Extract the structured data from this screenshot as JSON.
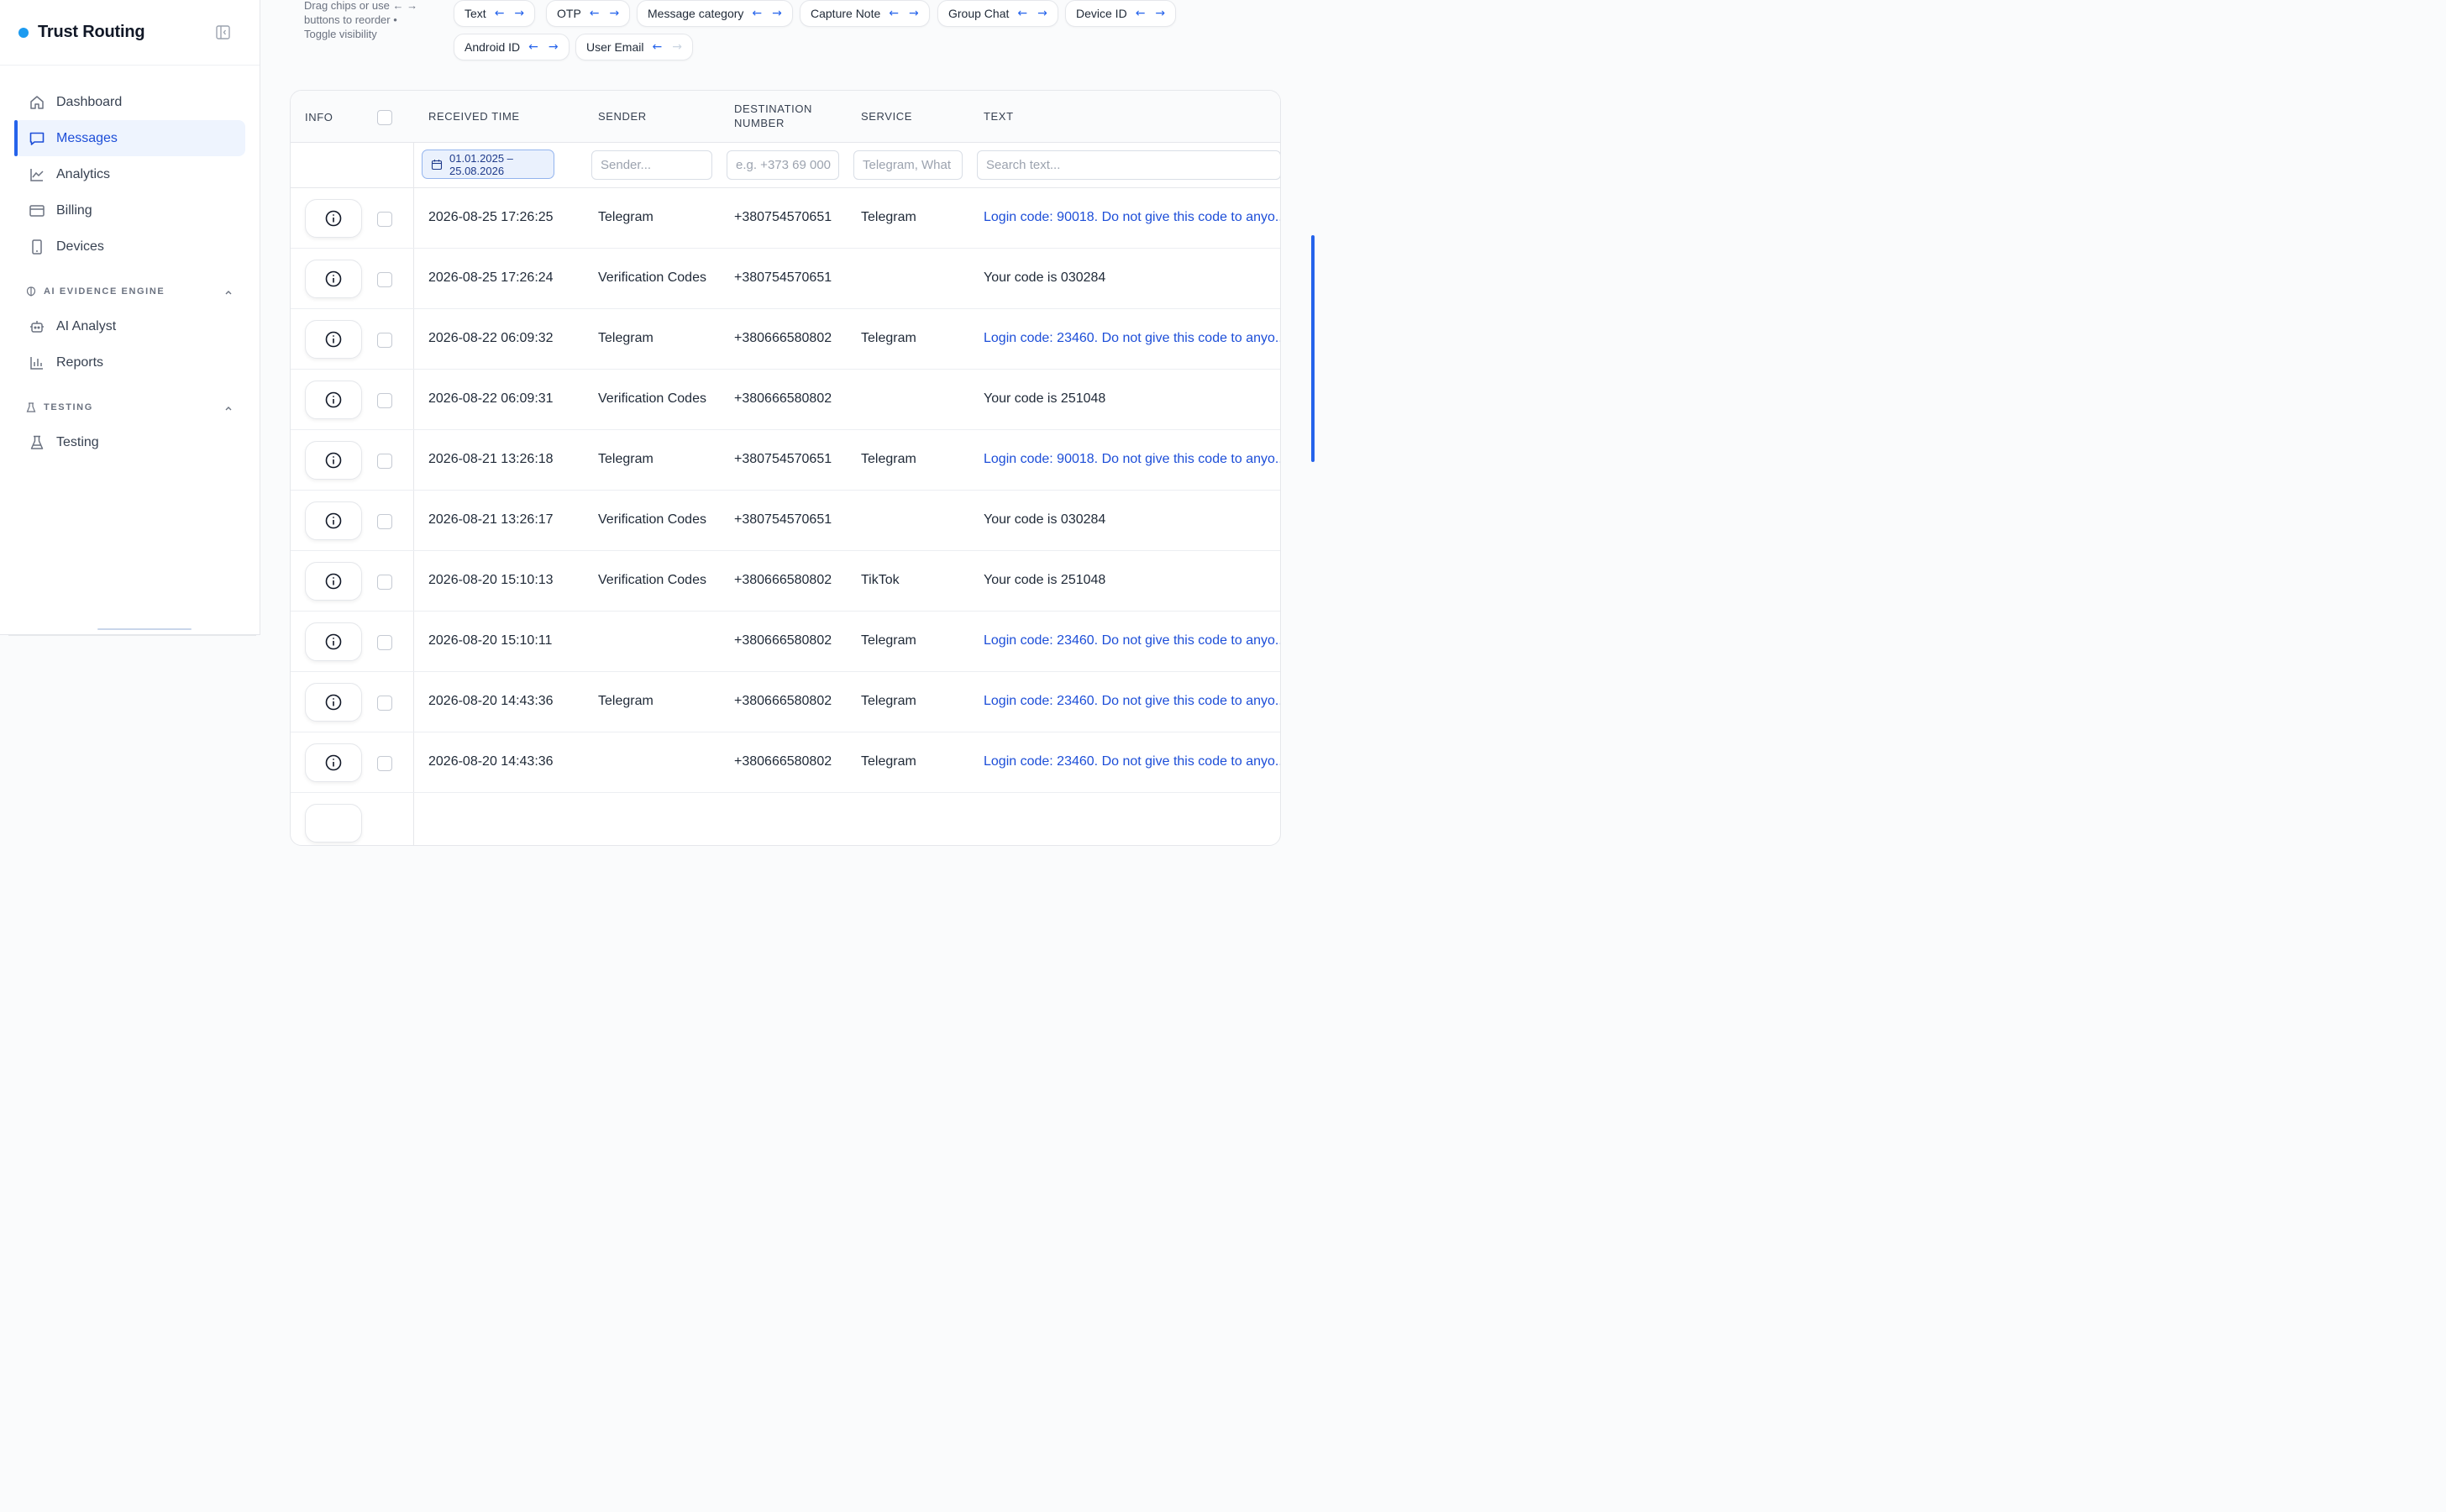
{
  "app": {
    "name": "Trust Routing",
    "brand_color": "#1d9bf0"
  },
  "sidebar": {
    "items": [
      {
        "label": "Dashboard",
        "icon": "home-icon"
      },
      {
        "label": "Messages",
        "icon": "message-icon",
        "active": true
      },
      {
        "label": "Analytics",
        "icon": "chart-line-icon"
      },
      {
        "label": "Billing",
        "icon": "credit-card-icon"
      },
      {
        "label": "Devices",
        "icon": "smartphone-icon"
      }
    ],
    "sections": [
      {
        "title": "AI EVIDENCE ENGINE",
        "icon": "brain-icon",
        "items": [
          {
            "label": "AI Analyst",
            "icon": "bot-icon"
          },
          {
            "label": "Reports",
            "icon": "bar-chart-icon"
          }
        ]
      },
      {
        "title": "TESTING",
        "icon": "flask-icon",
        "items": [
          {
            "label": "Testing",
            "icon": "flask-icon"
          }
        ]
      }
    ]
  },
  "columns_hint": "Drag chips or use ← → buttons to reorder • Toggle visibility",
  "column_chips": [
    "Text",
    "OTP",
    "Message category",
    "Capture Note",
    "Group Chat",
    "Device ID",
    "Android ID",
    "User Email"
  ],
  "table": {
    "headers": {
      "info": "INFO",
      "received": "RECEIVED TIME",
      "sender": "SENDER",
      "destination": "DESTINATION NUMBER",
      "service": "SERVICE",
      "text": "TEXT"
    },
    "filters": {
      "date_range": "01.01.2025 – 25.08.2026",
      "sender_placeholder": "Sender...",
      "destination_placeholder": "e.g. +373 69 000",
      "service_placeholder": "Telegram, What",
      "text_placeholder": "Search text..."
    },
    "rows": [
      {
        "time": "2026-08-25 17:26:25",
        "sender": "Telegram",
        "destination": "+380754570651",
        "service": "Telegram",
        "text": "Login code: 90018. Do not give this code to anyo...",
        "link": true
      },
      {
        "time": "2026-08-25 17:26:24",
        "sender": "Verification Codes",
        "destination": "+380754570651",
        "service": "",
        "text": "Your code is 030284",
        "link": false
      },
      {
        "time": "2026-08-22 06:09:32",
        "sender": "Telegram",
        "destination": "+380666580802",
        "service": "Telegram",
        "text": "Login code: 23460. Do not give this code to anyo...",
        "link": true
      },
      {
        "time": "2026-08-22 06:09:31",
        "sender": "Verification Codes",
        "destination": "+380666580802",
        "service": "",
        "text": "Your code is 251048",
        "link": false
      },
      {
        "time": "2026-08-21 13:26:18",
        "sender": "Telegram",
        "destination": "+380754570651",
        "service": "Telegram",
        "text": "Login code: 90018. Do not give this code to anyo...",
        "link": true
      },
      {
        "time": "2026-08-21 13:26:17",
        "sender": "Verification Codes",
        "destination": "+380754570651",
        "service": "",
        "text": "Your code is 030284",
        "link": false
      },
      {
        "time": "2026-08-20 15:10:13",
        "sender": "Verification Codes",
        "destination": "+380666580802",
        "service": "TikTok",
        "text": "Your code is 251048",
        "link": false
      },
      {
        "time": "2026-08-20 15:10:11",
        "sender": "",
        "destination": "+380666580802",
        "service": "Telegram",
        "text": "Login code: 23460. Do not give this code to anyo...",
        "link": true
      },
      {
        "time": "2026-08-20 14:43:36",
        "sender": "Telegram",
        "destination": "+380666580802",
        "service": "Telegram",
        "text": "Login code: 23460. Do not give this code to anyo...",
        "link": true
      },
      {
        "time": "2026-08-20 14:43:36",
        "sender": "",
        "destination": "+380666580802",
        "service": "Telegram",
        "text": "Login code: 23460. Do not give this code to anyo...",
        "link": true
      }
    ]
  }
}
